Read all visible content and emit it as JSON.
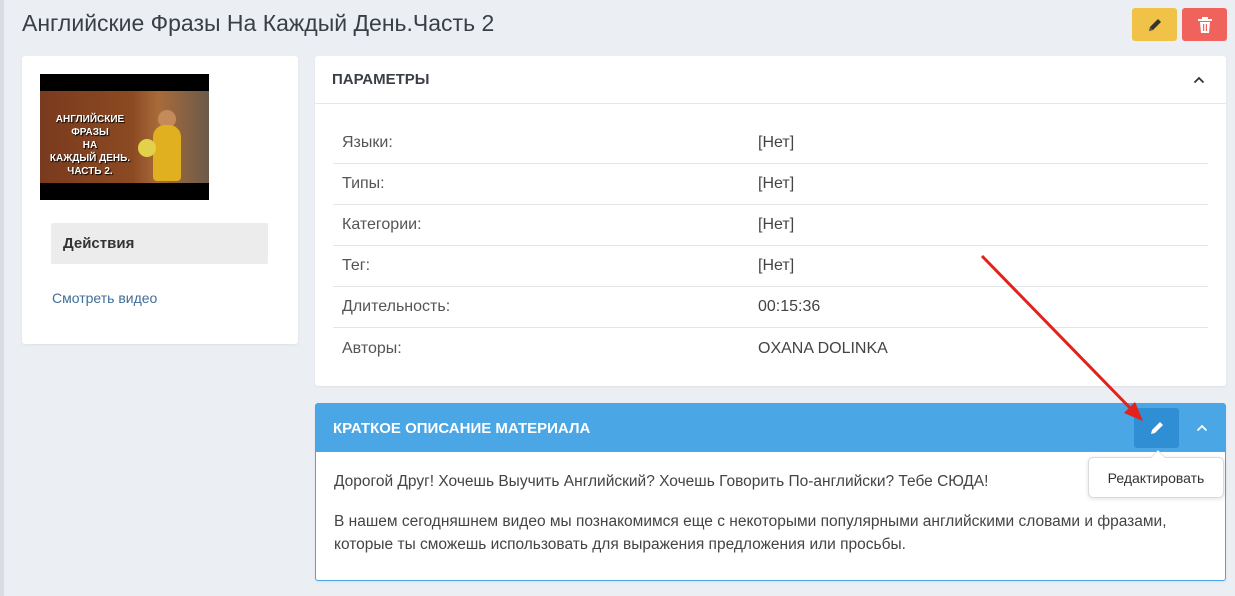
{
  "page": {
    "title": "Английские Фразы На Каждый День.Часть 2"
  },
  "title_actions": {
    "edit_icon": "pencil-icon",
    "delete_icon": "trash-icon",
    "edit_color": "#f0c247",
    "delete_color": "#f0625c"
  },
  "sidebar": {
    "thumbnail_text": "АНГЛИЙСКИЕ\nФРАЗЫ\nНА\nКАЖДЫЙ ДЕНЬ.\nЧАСТЬ 2.",
    "actions_label": "Действия",
    "watch_video_link": "Смотреть видео"
  },
  "params": {
    "title": "ПАРАМЕТРЫ",
    "rows": [
      {
        "key": "Языки:",
        "value": "[Нет]"
      },
      {
        "key": "Типы:",
        "value": "[Нет]"
      },
      {
        "key": "Категории:",
        "value": "[Нет]"
      },
      {
        "key": "Тег:",
        "value": "[Нет]"
      },
      {
        "key": "Длительность:",
        "value": "00:15:36"
      },
      {
        "key": "Авторы:",
        "value": "OXANA DOLINKA"
      }
    ]
  },
  "description": {
    "title": "КРАТКОЕ ОПИСАНИЕ МАТЕРИАЛА",
    "paragraph_1": "Дорогой Друг! Хочешь Выучить Английский? Хочешь Говорить По-английски? Тебе СЮДА!",
    "paragraph_2": "В нашем сегодняшнем видео мы познакомимся еще с некоторыми популярными английскими словами и фразами, которые ты сможешь использовать для выражения предложения или просьбы.",
    "header_color": "#4aa6e5"
  },
  "tooltip": {
    "text": "Редактировать"
  },
  "annotation": {
    "arrow_color": "#e3221c"
  }
}
